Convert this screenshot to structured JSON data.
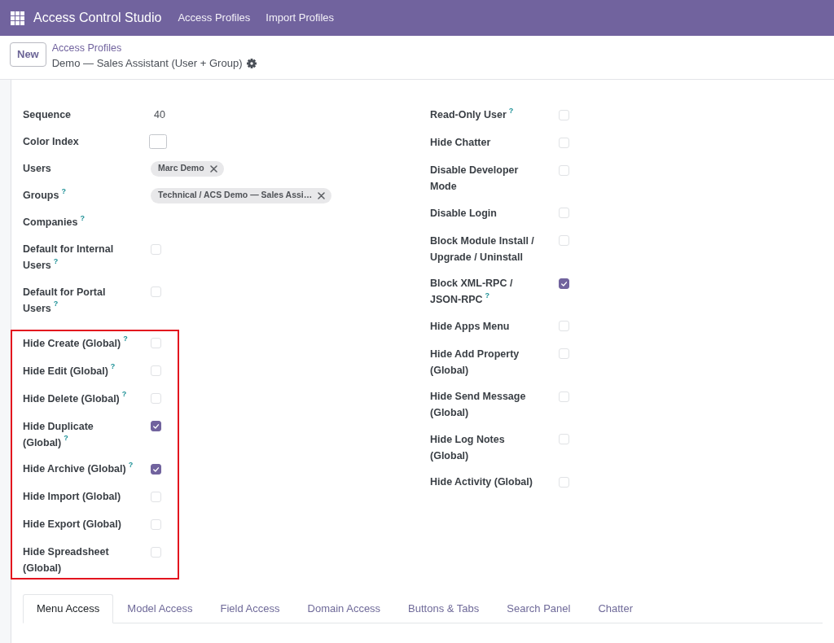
{
  "navbar": {
    "app_title": "Access Control Studio",
    "menu": [
      "Access Profiles",
      "Import Profiles"
    ]
  },
  "control_panel": {
    "new_button": "New",
    "breadcrumb": {
      "parent": "Access Profiles",
      "current": "Demo — Sales Assistant (User + Group)"
    }
  },
  "form": {
    "left_column": [
      {
        "kind": "text",
        "label": "Sequence",
        "value": "40"
      },
      {
        "kind": "color",
        "label": "Color Index"
      },
      {
        "kind": "tags",
        "label": "Users",
        "tags": [
          "Marc Demo"
        ]
      },
      {
        "kind": "tags",
        "label": "Groups$^{?}$",
        "tags": [
          "Technical / ACS Demo — Sales Assi…"
        ]
      },
      {
        "kind": "tags",
        "label": "Companies$^{?}$"
      },
      {
        "kind": "checkbox",
        "label": "Default for Internal Users$^{?}$",
        "checked": false
      },
      {
        "kind": "checkbox",
        "label": "Default for Portal Users$^{?}$",
        "checked": false
      }
    ],
    "highlighted_group": {
      "highlighted": true,
      "fields": [
        {
          "kind": "checkbox",
          "label": "Hide Create (Global)$^{?}$",
          "checked": false
        },
        {
          "kind": "checkbox",
          "label": "Hide Edit (Global)$^{?}$",
          "checked": false
        },
        {
          "kind": "checkbox",
          "label": "Hide Delete (Global)$^{?}$",
          "checked": false
        },
        {
          "kind": "checkbox",
          "label": "Hide Duplicate (Global)$^{?}$",
          "checked": true
        },
        {
          "kind": "checkbox",
          "label": "Hide Archive (Global)$^{?}$",
          "checked": true
        },
        {
          "kind": "checkbox",
          "label": "Hide Import (Global)",
          "checked": false
        },
        {
          "kind": "checkbox",
          "label": "Hide Export (Global)",
          "checked": false
        },
        {
          "kind": "checkbox",
          "label": "Hide Spreadsheet (Global)",
          "checked": false
        }
      ]
    },
    "right_column": [
      {
        "kind": "checkbox",
        "label": "Read-Only User$^{?}$",
        "checked": false
      },
      {
        "kind": "checkbox",
        "label": "Hide Chatter",
        "checked": false
      },
      {
        "kind": "checkbox",
        "label": "Disable Developer Mode",
        "checked": false
      },
      {
        "kind": "checkbox",
        "label": "Disable Login",
        "checked": false
      },
      {
        "kind": "checkbox",
        "label": "Block Module Install / Upgrade / Uninstall",
        "checked": false
      },
      {
        "kind": "checkbox",
        "label": "Block XML-RPC / JSON-RPC$^{?}$",
        "checked": true
      },
      {
        "kind": "checkbox",
        "label": "Hide Apps Menu",
        "checked": false
      },
      {
        "kind": "checkbox",
        "label": "Hide Add Property (Global)",
        "checked": false
      },
      {
        "kind": "checkbox",
        "label": "Hide Send Message (Global)",
        "checked": false
      },
      {
        "kind": "checkbox",
        "label": "Hide Log Notes (Global)",
        "checked": false
      },
      {
        "kind": "checkbox",
        "label": "Hide Activity (Global)",
        "checked": false
      }
    ]
  },
  "tabs": [
    {
      "label": "Menu Access",
      "selected": true
    },
    {
      "label": "Model Access",
      "selected": false
    },
    {
      "label": "Field Access",
      "selected": false
    },
    {
      "label": "Domain Access",
      "selected": false
    },
    {
      "label": "Buttons & Tabs",
      "selected": false
    },
    {
      "label": "Search Panel",
      "selected": false
    },
    {
      "label": "Chatter",
      "selected": false
    }
  ]
}
